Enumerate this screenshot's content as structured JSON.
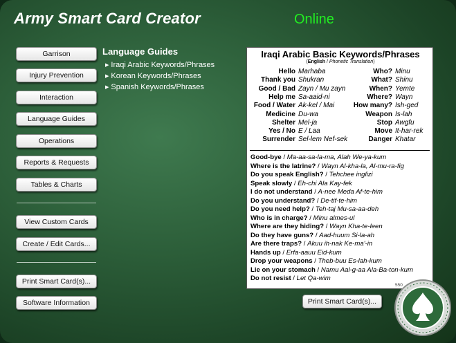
{
  "app": {
    "title": "Army Smart Card Creator",
    "status": "Online",
    "status_color": "#22ee22"
  },
  "nav": {
    "buttons": [
      {
        "label": "Garrison"
      },
      {
        "label": "Injury Prevention"
      },
      {
        "label": "Interaction"
      },
      {
        "label": "Language Guides"
      },
      {
        "label": "Operations"
      },
      {
        "label": "Reports & Requests"
      },
      {
        "label": "Tables & Charts"
      },
      {
        "label": "View Custom Cards"
      },
      {
        "label": "Create / Edit Cards..."
      },
      {
        "label": "Print Smart Card(s)..."
      },
      {
        "label": "Software Information"
      }
    ]
  },
  "guides": {
    "heading": "Language Guides",
    "items": [
      {
        "label": "Iraqi Arabic Keywords/Phrases"
      },
      {
        "label": "Korean Keywords/Phrases"
      },
      {
        "label": "Spanish Keywords/Phrases"
      }
    ]
  },
  "card": {
    "title": "Iraqi Arabic Basic Keywords/Phrases",
    "subtitle_bold": "English",
    "subtitle_sep": " / ",
    "subtitle_rest": "Phonetic Translation",
    "keywords_left": [
      {
        "en": "Hello",
        "ar": "Marhaba"
      },
      {
        "en": "Thank you",
        "ar": "Shukran"
      },
      {
        "en": "Good / Bad",
        "ar": "Zayn / Mu zayn"
      },
      {
        "en": "Help me",
        "ar": "Sa-aaid-ni"
      },
      {
        "en": "Food / Water",
        "ar": "Ak-kel / Mai"
      },
      {
        "en": "Medicine",
        "ar": "Du-wa"
      },
      {
        "en": "Shelter",
        "ar": "Mel-ja"
      },
      {
        "en": "Yes / No",
        "ar": "E / Laa"
      },
      {
        "en": "Surrender",
        "ar": "Sel-lem Nef-sek"
      }
    ],
    "keywords_right": [
      {
        "en": "Who?",
        "ar": "Minu"
      },
      {
        "en": "What?",
        "ar": "Shinu"
      },
      {
        "en": "When?",
        "ar": "Yemte"
      },
      {
        "en": "Where?",
        "ar": "Wayn"
      },
      {
        "en": "How many?",
        "ar": "Ish-ged"
      },
      {
        "en": "Weapon",
        "ar": "Is-lah"
      },
      {
        "en": "Stop",
        "ar": "Awgfu"
      },
      {
        "en": "Move",
        "ar": "It-har-rek"
      },
      {
        "en": "Danger",
        "ar": "Khatar"
      }
    ],
    "phrases": [
      {
        "en": "Good-bye",
        "tr": "Ma-aa-sa-la-ma, Alah We-ya-kum"
      },
      {
        "en": "Where is the latrine?",
        "tr": "Wayn Al-kha-la, Al-mu-ra-fig"
      },
      {
        "en": "Do you speak English?",
        "tr": "Tehchee inglizi"
      },
      {
        "en": "Speak slowly",
        "tr": "Eh-chi Ala Kay-fek"
      },
      {
        "en": "I do not understand",
        "tr": "A-nee Meda Af-te-him"
      },
      {
        "en": "Do you understand?",
        "tr": "De-tif-te-him"
      },
      {
        "en": "Do you need help?",
        "tr": "Teh-taj Mu-sa-aa-deh"
      },
      {
        "en": "Who is in charge?",
        "tr": "Minu almes-ul"
      },
      {
        "en": "Where are they hiding?",
        "tr": "Wayn Kha-te-leen"
      },
      {
        "en": "Do they have guns?",
        "tr": "Aad-huum Si-la-ah"
      },
      {
        "en": "Are there traps?",
        "tr": "Akuu ih-nak Ke-ma'-in"
      },
      {
        "en": "Hands up",
        "tr": "Erfa-aauu Eid-kum"
      },
      {
        "en": "Drop your weapons",
        "tr": "Theb-buu Es-lah-kum"
      },
      {
        "en": "Lie on your stomach",
        "tr": "Namu Aal-g-aa Ala-Ba-ton-kum"
      },
      {
        "en": "Do not resist",
        "tr": "Let Qa-wim"
      }
    ],
    "phrase_sep": " / ",
    "code": "550"
  },
  "print_button": {
    "label": "Print Smart Card(s)..."
  },
  "logo": {
    "icon": "ace-spade-seal-icon"
  },
  "colors": {
    "background": "#2c5e39",
    "text": "#ffffff"
  }
}
